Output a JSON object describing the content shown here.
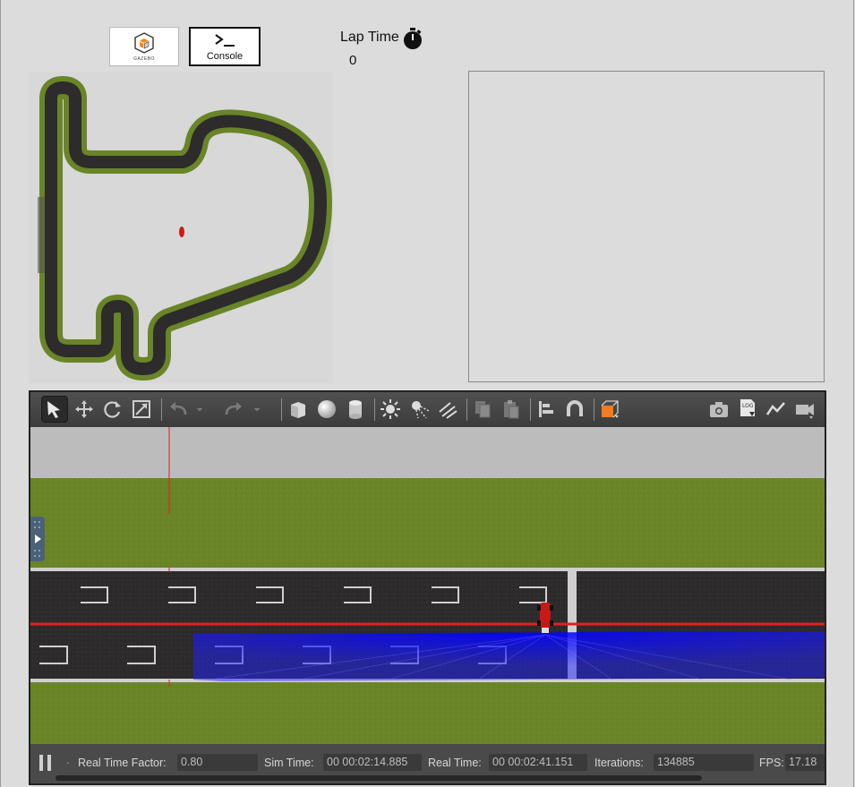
{
  "top_buttons": {
    "gazebo": {
      "label": "GAZEBO",
      "icon": "gazebo-logo-icon"
    },
    "console": {
      "label": "Console",
      "icon": "terminal-icon"
    }
  },
  "lap_time": {
    "title": "Lap Time",
    "value": "0",
    "icon": "stopwatch-icon"
  },
  "toolbar": {
    "tools": [
      "select-tool",
      "translate-tool",
      "rotate-tool",
      "scale-tool",
      "undo",
      "redo",
      "box-shape",
      "sphere-shape",
      "cylinder-shape",
      "point-light",
      "spot-light",
      "directional-light",
      "copy",
      "paste",
      "align",
      "snap",
      "view-angle"
    ],
    "right_tools": [
      "screenshot",
      "log",
      "plot",
      "record-video"
    ]
  },
  "status_bar": {
    "real_time_factor_label": "Real Time Factor:",
    "real_time_factor": "0.80",
    "sim_time_label": "Sim Time:",
    "sim_time": "00 00:02:14.885",
    "real_time_label": "Real Time:",
    "real_time": "00 00:02:41.151",
    "iterations_label": "Iterations:",
    "iterations": "134885",
    "fps_label": "FPS:",
    "fps": "17.18"
  },
  "colors": {
    "grass": "#6a8428",
    "asphalt": "#2d2b2b",
    "line_red": "#e02020",
    "laser_blue": "#1010ff",
    "toolbar_bg": "#474747",
    "status_bg": "#4a4a4a"
  }
}
